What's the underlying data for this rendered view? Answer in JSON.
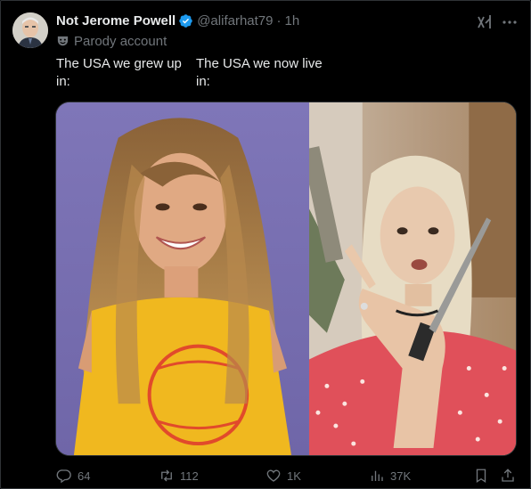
{
  "author": {
    "display_name": "Not Jerome Powell",
    "handle": "@alifarhat79",
    "separator": "·",
    "time": "1h",
    "label": "Parody account"
  },
  "colors": {
    "verified_badge": "#1d9bf0",
    "secondary_text": "#71767b",
    "primary_text": "#e7e9ea",
    "background": "#000000"
  },
  "post": {
    "caption_left": "The USA we grew up in:",
    "caption_right": "The USA we now live in:"
  },
  "icons": {
    "verified": "verified-badge-icon",
    "parody": "parody-mask-icon",
    "grok": "grok-icon",
    "more": "more-options-icon",
    "reply": "reply-icon",
    "retweet": "retweet-icon",
    "like": "heart-icon",
    "views": "views-chart-icon",
    "bookmark": "bookmark-icon",
    "share": "share-icon"
  },
  "stats": {
    "replies": "64",
    "retweets": "112",
    "likes": "1K",
    "views": "37K"
  }
}
